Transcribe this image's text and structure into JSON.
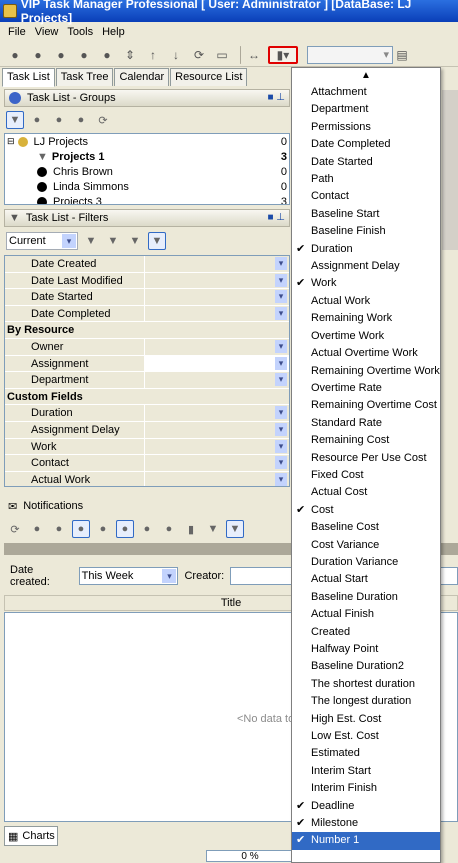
{
  "window": {
    "title": "VIP Task Manager Professional [ User: Administrator ] [DataBase: LJ Projects]"
  },
  "menu": [
    "File",
    "View",
    "Tools",
    "Help"
  ],
  "tabs": [
    "Task List",
    "Task Tree",
    "Calendar",
    "Resource List"
  ],
  "groups_panel": {
    "title": "Task List - Groups",
    "tree": [
      {
        "label": "LJ Projects",
        "count": "0"
      },
      {
        "label": "Projects 1",
        "count": "3"
      },
      {
        "label": "Chris Brown",
        "count": "0"
      },
      {
        "label": "Linda Simmons",
        "count": "0"
      },
      {
        "label": "Projects 3",
        "count": "3"
      }
    ]
  },
  "filters_panel": {
    "title": "Task List - Filters",
    "current": "Current",
    "rows": [
      {
        "label": "Date Created"
      },
      {
        "label": "Date Last Modified"
      },
      {
        "label": "Date Started"
      },
      {
        "label": "Date Completed"
      },
      {
        "label": "By Resource",
        "section": true
      },
      {
        "label": "Owner"
      },
      {
        "label": "Assignment"
      },
      {
        "label": "Department"
      },
      {
        "label": "Custom Fields",
        "section": true
      },
      {
        "label": "Duration"
      },
      {
        "label": "Assignment Delay"
      },
      {
        "label": "Work"
      },
      {
        "label": "Contact"
      },
      {
        "label": "Actual Work"
      }
    ]
  },
  "notifications": {
    "title": "Notifications",
    "date_created_label": "Date created:",
    "date_created_value": "This Week",
    "creator_label": "Creator:",
    "column_title": "Title",
    "no_data": "<No data to d"
  },
  "bottom": {
    "charts_tab": "Charts",
    "progress": "0 %"
  },
  "column_menu": {
    "items": [
      {
        "label": "Attachment",
        "checked": false
      },
      {
        "label": "Department",
        "checked": false
      },
      {
        "label": "Permissions",
        "checked": false
      },
      {
        "label": "Date Completed",
        "checked": false
      },
      {
        "label": "Date Started",
        "checked": false
      },
      {
        "label": "Path",
        "checked": false
      },
      {
        "label": "Contact",
        "checked": false
      },
      {
        "label": "Baseline Start",
        "checked": false
      },
      {
        "label": "Baseline Finish",
        "checked": false
      },
      {
        "label": "Duration",
        "checked": true
      },
      {
        "label": "Assignment Delay",
        "checked": false
      },
      {
        "label": "Work",
        "checked": true
      },
      {
        "label": "Actual Work",
        "checked": false
      },
      {
        "label": "Remaining Work",
        "checked": false
      },
      {
        "label": "Overtime Work",
        "checked": false
      },
      {
        "label": "Actual Overtime Work",
        "checked": false
      },
      {
        "label": "Remaining Overtime Work",
        "checked": false
      },
      {
        "label": "Overtime Rate",
        "checked": false
      },
      {
        "label": "Remaining Overtime Cost",
        "checked": false
      },
      {
        "label": "Standard Rate",
        "checked": false
      },
      {
        "label": "Remaining Cost",
        "checked": false
      },
      {
        "label": "Resource Per Use Cost",
        "checked": false
      },
      {
        "label": "Fixed Cost",
        "checked": false
      },
      {
        "label": "Actual Cost",
        "checked": false
      },
      {
        "label": "Cost",
        "checked": true
      },
      {
        "label": "Baseline Cost",
        "checked": false
      },
      {
        "label": "Cost Variance",
        "checked": false
      },
      {
        "label": "Duration Variance",
        "checked": false
      },
      {
        "label": "Actual Start",
        "checked": false
      },
      {
        "label": "Baseline Duration",
        "checked": false
      },
      {
        "label": "Actual Finish",
        "checked": false
      },
      {
        "label": "Created",
        "checked": false
      },
      {
        "label": "Halfway Point",
        "checked": false
      },
      {
        "label": "Baseline Duration2",
        "checked": false
      },
      {
        "label": "The shortest duration",
        "checked": false
      },
      {
        "label": "The longest duration",
        "checked": false
      },
      {
        "label": "High Est. Cost",
        "checked": false
      },
      {
        "label": "Low Est. Cost",
        "checked": false
      },
      {
        "label": "Estimated",
        "checked": false
      },
      {
        "label": "Interim Start",
        "checked": false
      },
      {
        "label": "Interim Finish",
        "checked": false
      },
      {
        "label": "Deadline",
        "checked": true
      },
      {
        "label": "Milestone",
        "checked": true
      },
      {
        "label": "Number 1",
        "checked": true,
        "highlighted": true
      }
    ]
  }
}
